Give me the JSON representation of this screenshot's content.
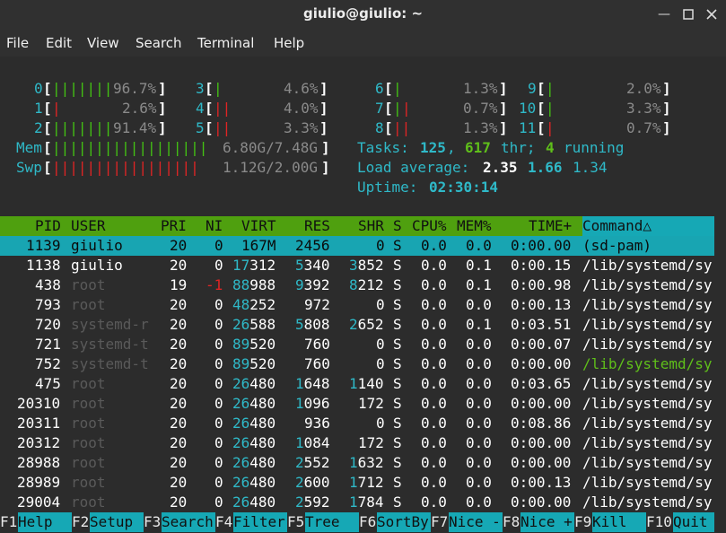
{
  "window": {
    "title": "giulio@giulio: ~"
  },
  "menu": [
    "File",
    "Edit",
    "View",
    "Search",
    "Terminal",
    "Help"
  ],
  "cpus": [
    {
      "id": "0",
      "pct": "96.7%"
    },
    {
      "id": "1",
      "pct": "2.6%"
    },
    {
      "id": "2",
      "pct": "91.4%"
    },
    {
      "id": "3",
      "pct": "4.6%"
    },
    {
      "id": "4",
      "pct": "4.0%"
    },
    {
      "id": "5",
      "pct": "3.3%"
    },
    {
      "id": "6",
      "pct": "1.3%"
    },
    {
      "id": "7",
      "pct": "0.7%"
    },
    {
      "id": "8",
      "pct": "1.3%"
    },
    {
      "id": "9",
      "pct": "2.0%"
    },
    {
      "id": "10",
      "pct": "3.3%"
    },
    {
      "id": "11",
      "pct": "0.7%"
    }
  ],
  "mem": {
    "label": "Mem",
    "value": "6.80G/7.48G"
  },
  "swp": {
    "label": "Swp",
    "value": "1.12G/2.00G"
  },
  "tasks": {
    "label": "Tasks:",
    "count": "125",
    "thr": "617",
    "thr_label": "thr;",
    "running": "4",
    "running_label": "running"
  },
  "load": {
    "label": "Load average:",
    "l1": "2.35",
    "l5": "1.66",
    "l15": "1.34"
  },
  "uptime": {
    "label": "Uptime:",
    "value": "02:30:14"
  },
  "columns": [
    "PID",
    "USER",
    "PRI",
    "NI",
    "VIRT",
    "RES",
    "SHR",
    "S",
    "CPU%",
    "MEM%",
    "TIME+",
    "Command△"
  ],
  "processes": [
    {
      "pid": "1139",
      "user": "giulio",
      "pri": "20",
      "ni": "0",
      "virt": "167M",
      "res": "2456",
      "shr": "0",
      "s": "S",
      "cpu": "0.0",
      "mem": "0.0",
      "time": "0:00.00",
      "cmd": "(sd-pam)"
    },
    {
      "pid": "1138",
      "user": "giulio",
      "pri": "20",
      "ni": "0",
      "virt": "17312",
      "res": "5340",
      "shr": "3852",
      "s": "S",
      "cpu": "0.0",
      "mem": "0.1",
      "time": "0:00.15",
      "cmd": "/lib/systemd/sy"
    },
    {
      "pid": "438",
      "user": "root",
      "pri": "19",
      "ni": "-1",
      "virt": "88988",
      "res": "9392",
      "shr": "8212",
      "s": "S",
      "cpu": "0.0",
      "mem": "0.1",
      "time": "0:00.98",
      "cmd": "/lib/systemd/sy"
    },
    {
      "pid": "793",
      "user": "root",
      "pri": "20",
      "ni": "0",
      "virt": "48252",
      "res": "972",
      "shr": "0",
      "s": "S",
      "cpu": "0.0",
      "mem": "0.0",
      "time": "0:00.13",
      "cmd": "/lib/systemd/sy"
    },
    {
      "pid": "720",
      "user": "systemd-r",
      "pri": "20",
      "ni": "0",
      "virt": "26588",
      "res": "5808",
      "shr": "2652",
      "s": "S",
      "cpu": "0.0",
      "mem": "0.1",
      "time": "0:03.51",
      "cmd": "/lib/systemd/sy"
    },
    {
      "pid": "721",
      "user": "systemd-t",
      "pri": "20",
      "ni": "0",
      "virt": "89520",
      "res": "760",
      "shr": "0",
      "s": "S",
      "cpu": "0.0",
      "mem": "0.0",
      "time": "0:00.07",
      "cmd": "/lib/systemd/sy"
    },
    {
      "pid": "752",
      "user": "systemd-t",
      "pri": "20",
      "ni": "0",
      "virt": "89520",
      "res": "760",
      "shr": "0",
      "s": "S",
      "cpu": "0.0",
      "mem": "0.0",
      "time": "0:00.00",
      "cmd": "/lib/systemd/sy"
    },
    {
      "pid": "475",
      "user": "root",
      "pri": "20",
      "ni": "0",
      "virt": "26480",
      "res": "1648",
      "shr": "1140",
      "s": "S",
      "cpu": "0.0",
      "mem": "0.0",
      "time": "0:03.65",
      "cmd": "/lib/systemd/sy"
    },
    {
      "pid": "20310",
      "user": "root",
      "pri": "20",
      "ni": "0",
      "virt": "26480",
      "res": "1096",
      "shr": "172",
      "s": "S",
      "cpu": "0.0",
      "mem": "0.0",
      "time": "0:00.00",
      "cmd": "/lib/systemd/sy"
    },
    {
      "pid": "20311",
      "user": "root",
      "pri": "20",
      "ni": "0",
      "virt": "26480",
      "res": "936",
      "shr": "0",
      "s": "S",
      "cpu": "0.0",
      "mem": "0.0",
      "time": "0:08.86",
      "cmd": "/lib/systemd/sy"
    },
    {
      "pid": "20312",
      "user": "root",
      "pri": "20",
      "ni": "0",
      "virt": "26480",
      "res": "1084",
      "shr": "172",
      "s": "S",
      "cpu": "0.0",
      "mem": "0.0",
      "time": "0:00.00",
      "cmd": "/lib/systemd/sy"
    },
    {
      "pid": "28988",
      "user": "root",
      "pri": "20",
      "ni": "0",
      "virt": "26480",
      "res": "2552",
      "shr": "1632",
      "s": "S",
      "cpu": "0.0",
      "mem": "0.0",
      "time": "0:00.00",
      "cmd": "/lib/systemd/sy"
    },
    {
      "pid": "28989",
      "user": "root",
      "pri": "20",
      "ni": "0",
      "virt": "26480",
      "res": "2600",
      "shr": "1712",
      "s": "S",
      "cpu": "0.0",
      "mem": "0.0",
      "time": "0:00.13",
      "cmd": "/lib/systemd/sy"
    },
    {
      "pid": "29004",
      "user": "root",
      "pri": "20",
      "ni": "0",
      "virt": "26480",
      "res": "2592",
      "shr": "1784",
      "s": "S",
      "cpu": "0.0",
      "mem": "0.0",
      "time": "0:00.00",
      "cmd": "/lib/systemd/sy"
    }
  ],
  "fkeys": [
    {
      "key": "F1",
      "label": "Help"
    },
    {
      "key": "F2",
      "label": "Setup"
    },
    {
      "key": "F3",
      "label": "Search"
    },
    {
      "key": "F4",
      "label": "Filter"
    },
    {
      "key": "F5",
      "label": "Tree"
    },
    {
      "key": "F6",
      "label": "SortBy"
    },
    {
      "key": "F7",
      "label": "Nice -"
    },
    {
      "key": "F8",
      "label": "Nice +"
    },
    {
      "key": "F9",
      "label": "Kill"
    },
    {
      "key": "F10",
      "label": "Quit"
    }
  ],
  "colors": {
    "header_bg": "#4fa00f",
    "selected_bg": "#18a5b2",
    "fkey_bg": "#16a8b5",
    "cyan": "#2fb9c8",
    "green": "#5fbf1a",
    "red": "#e02424"
  },
  "icons": [
    "minimize-icon",
    "maximize-icon",
    "close-icon"
  ]
}
